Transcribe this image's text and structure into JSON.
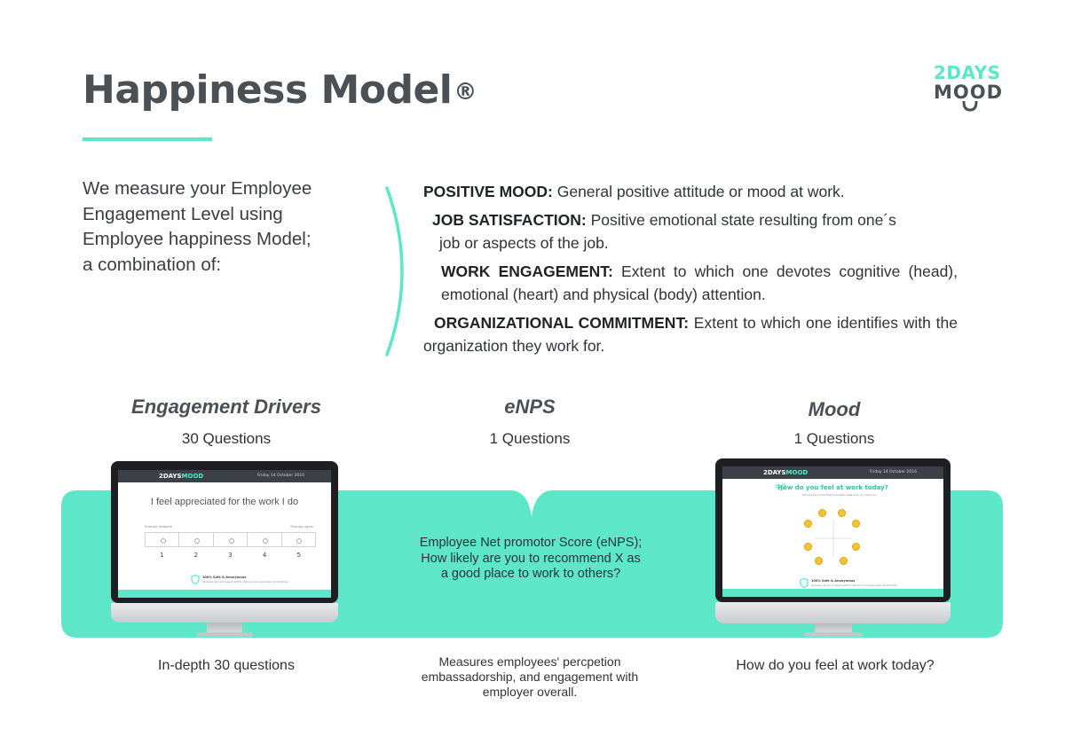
{
  "header": {
    "title": "Happiness Model",
    "registered_mark": "®",
    "accent_color": "#5ee6c9"
  },
  "logo": {
    "line1": "2DAYS",
    "line2": "MOOD"
  },
  "intro": {
    "line1": "We measure your Employee",
    "line2": "Engagement Level using",
    "line3": "Employee happiness Model;",
    "line4": "a combination of:"
  },
  "definitions": {
    "positive_mood": {
      "term": "POSITIVE MOOD:",
      "text": " General positive attitude or mood at work."
    },
    "job_satisfaction": {
      "term": "JOB SATISFACTION:",
      "text": " Positive emotional state resulting from one´s",
      "text2": "job or aspects of the job."
    },
    "work_engagement": {
      "term": "WORK ENGAGEMENT:",
      "text": " Extent to which one devotes cognitive (head), emotional (heart) and physical (body) attention."
    },
    "organizational_commitment": {
      "term": "ORGANIZATIONAL COMMITMENT:",
      "text": " Extent to which one identifies with the organization they work for."
    }
  },
  "columns": {
    "drivers": {
      "title": "Engagement Drivers",
      "subtitle": "30 Questions",
      "caption": "In-depth 30 questions"
    },
    "enps": {
      "title": "eNPS",
      "subtitle": "1 Questions",
      "description": "Employee Net promotor Score (eNPS); How likely are you to recommend X as a good place to work to others?",
      "caption": "Measures employees' percpetion embassadorship, and engagement with employer overall."
    },
    "mood": {
      "title": "Mood",
      "subtitle": "1 Questions",
      "caption": "How do you feel at work today?"
    }
  },
  "screen_left": {
    "logo_a": "2DAYS",
    "logo_b": "MOOD",
    "date": "Friday 14 October 2016",
    "question": "I feel appreciated for the work I do",
    "left_anchor": "Strongly disagree",
    "right_anchor": "Strongly agree",
    "scale": [
      "1",
      "2",
      "3",
      "4",
      "5"
    ],
    "safe_title": "100% Safe & Anonymous",
    "safe_text": "Answers are processed 100% safe and anonymously at all times"
  },
  "screen_right": {
    "logo_a": "2DAYS",
    "logo_b": "MOOD",
    "date": "Friday 14 October 2016",
    "question": "How do you feel at work today?",
    "instruction": "Choose the mood that describes best how you feel now",
    "safe_title": "100% Safe & Anonymous",
    "safe_text": "Answers are processed 100% safe and anonymously at all times"
  }
}
